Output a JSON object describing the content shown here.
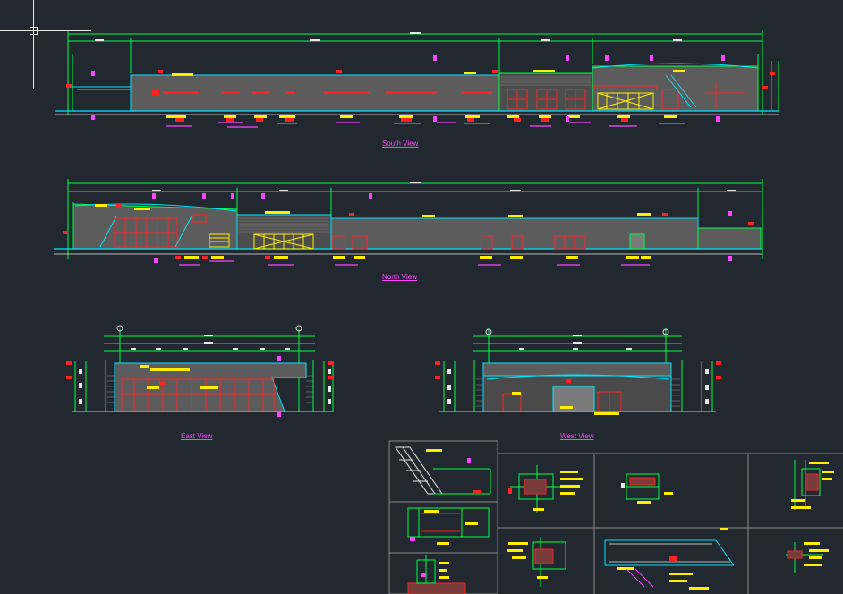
{
  "views": {
    "south": {
      "title": "South View"
    },
    "north": {
      "title": "North View"
    },
    "east": {
      "title": "East View"
    },
    "west": {
      "title": "West View"
    }
  },
  "colors": {
    "background": "#212830",
    "dimension": "#00ff44",
    "outline": "#00e5ff",
    "frame": "#ff2222",
    "label": "#ffee00",
    "annotation": "#ff44ff",
    "fill": "#5c5c5c",
    "grid": "#8a8a8a"
  },
  "cursor": {
    "icon": "crosshair-cursor-icon"
  }
}
